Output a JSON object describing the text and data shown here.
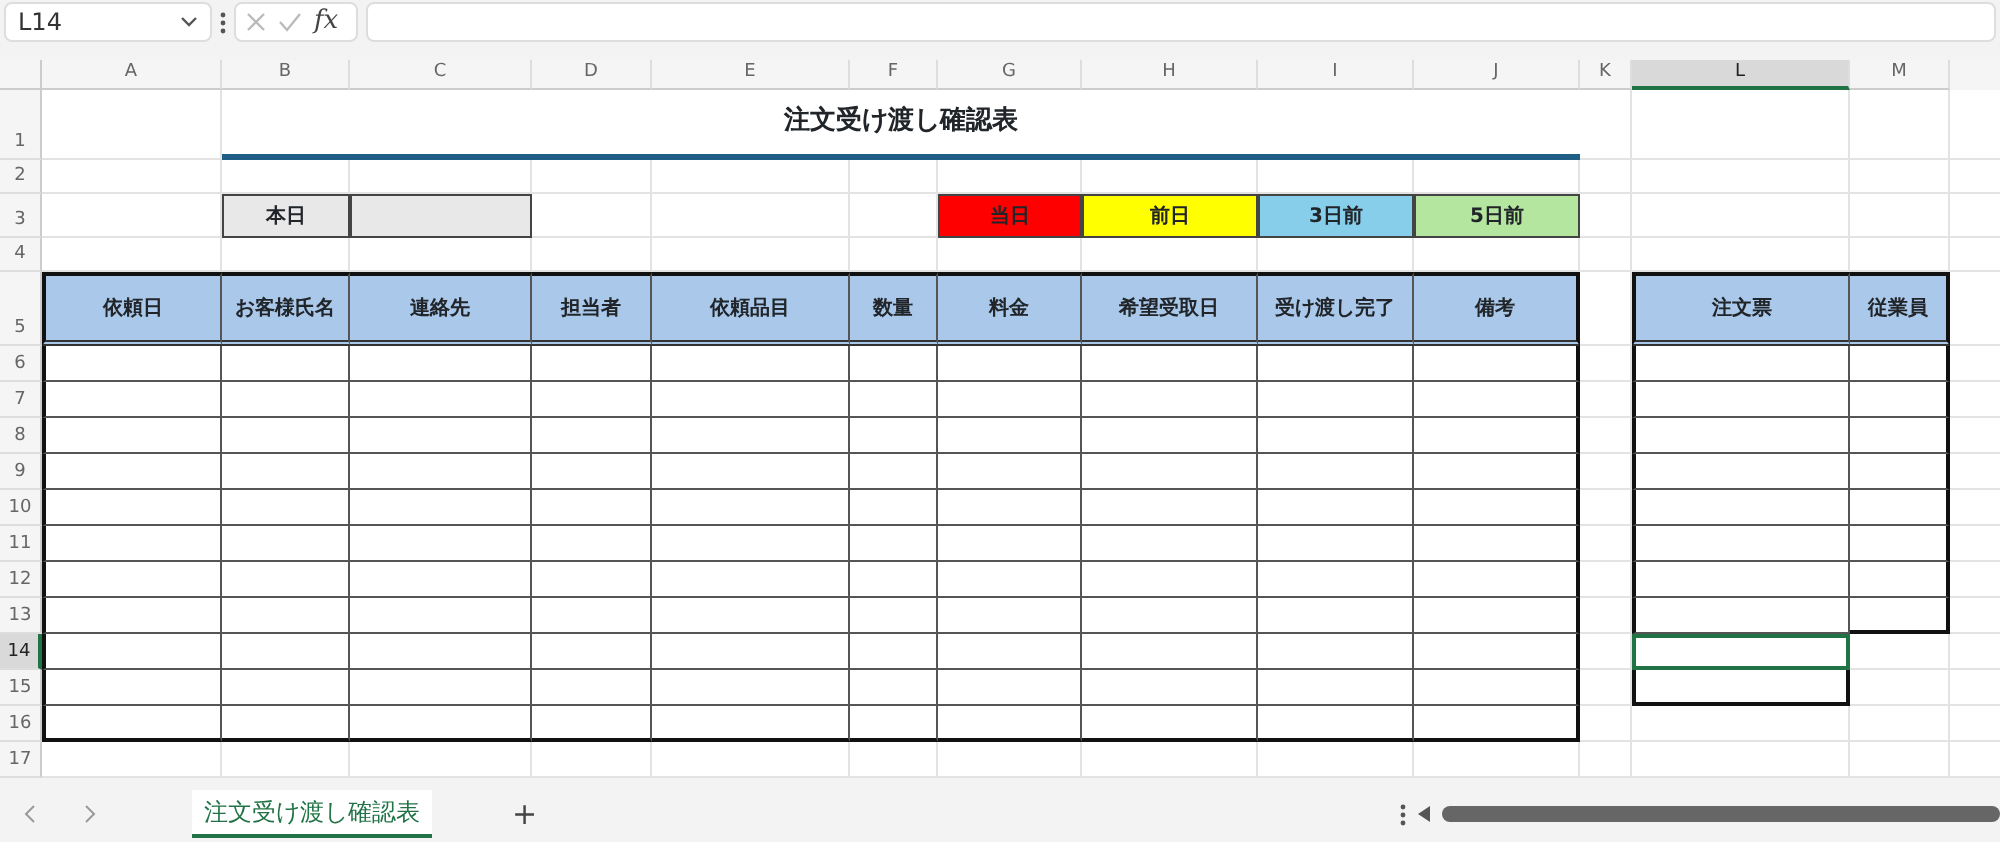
{
  "formula_bar": {
    "name_box": "L14",
    "function_label": "fx"
  },
  "column_headers": [
    {
      "label": "A",
      "selected": false
    },
    {
      "label": "B",
      "selected": false
    },
    {
      "label": "C",
      "selected": false
    },
    {
      "label": "D",
      "selected": false
    },
    {
      "label": "E",
      "selected": false
    },
    {
      "label": "F",
      "selected": false
    },
    {
      "label": "G",
      "selected": false
    },
    {
      "label": "H",
      "selected": false
    },
    {
      "label": "I",
      "selected": false
    },
    {
      "label": "J",
      "selected": false
    },
    {
      "label": "K",
      "selected": false
    },
    {
      "label": "L",
      "selected": true
    },
    {
      "label": "M",
      "selected": false
    }
  ],
  "row_headers": [
    {
      "label": "1",
      "selected": false
    },
    {
      "label": "2",
      "selected": false
    },
    {
      "label": "3",
      "selected": false
    },
    {
      "label": "4",
      "selected": false
    },
    {
      "label": "5",
      "selected": false
    },
    {
      "label": "6",
      "selected": false
    },
    {
      "label": "7",
      "selected": false
    },
    {
      "label": "8",
      "selected": false
    },
    {
      "label": "9",
      "selected": false
    },
    {
      "label": "10",
      "selected": false
    },
    {
      "label": "11",
      "selected": false
    },
    {
      "label": "12",
      "selected": false
    },
    {
      "label": "13",
      "selected": false
    },
    {
      "label": "14",
      "selected": true
    },
    {
      "label": "15",
      "selected": false
    },
    {
      "label": "16",
      "selected": false
    },
    {
      "label": "17",
      "selected": false
    }
  ],
  "title": "注文受け渡し確認表",
  "today_label": "本日",
  "legend": [
    {
      "label": "当日",
      "color": "#ff0000"
    },
    {
      "label": "前日",
      "color": "#ffff00"
    },
    {
      "label": "3日前",
      "color": "#87ceeb"
    },
    {
      "label": "5日前",
      "color": "#b4e6a0"
    }
  ],
  "table": {
    "columns": [
      "依頼日",
      "お客様氏名",
      "連絡先",
      "担当者",
      "依頼品目",
      "数量",
      "料金",
      "希望受取日",
      "受け渡し完了",
      "備考"
    ]
  },
  "side_table": {
    "columns": [
      "注文票",
      "従業員"
    ]
  },
  "sheet_tabs": [
    {
      "label": "注文受け渡し確認表",
      "selected": true
    }
  ],
  "add_sheet": "+"
}
